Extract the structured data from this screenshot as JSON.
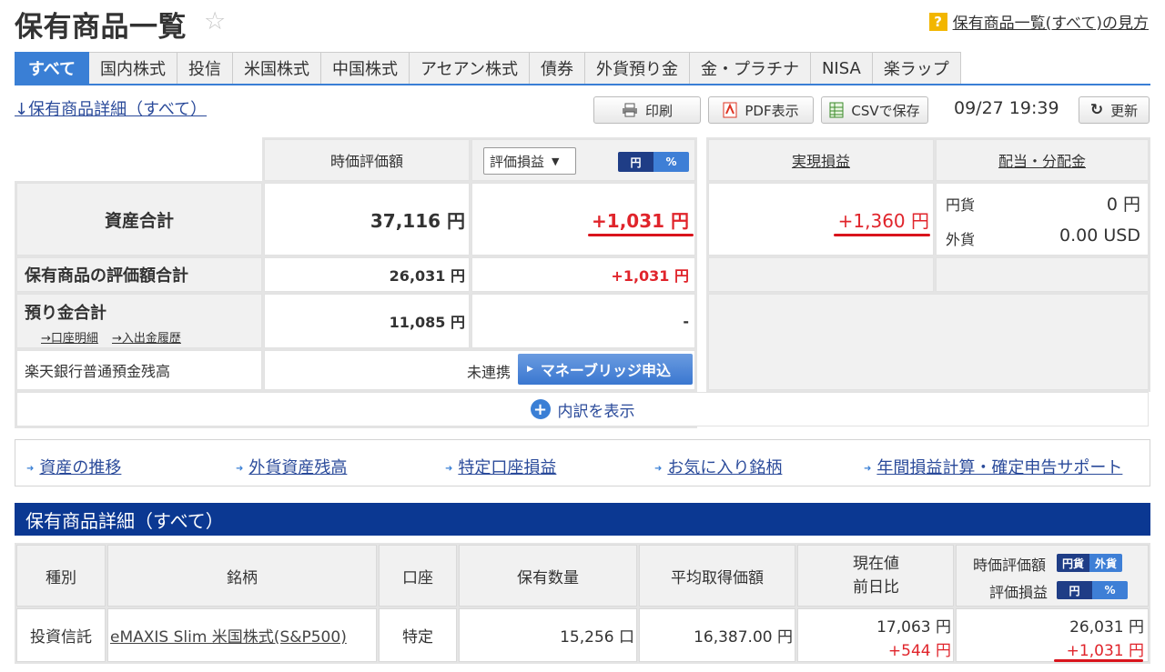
{
  "header": {
    "title": "保有商品一覧",
    "help_link": "保有商品一覧(すべて)の見方"
  },
  "tabs": [
    "すべて",
    "国内株式",
    "投信",
    "米国株式",
    "中国株式",
    "アセアン株式",
    "債券",
    "外貨預り金",
    "金・プラチナ",
    "NISA",
    "楽ラップ"
  ],
  "toolbar": {
    "detail_link": "↓保有商品詳細（すべて）",
    "print": "印刷",
    "pdf": "PDF表示",
    "csv": "CSVで保存",
    "timestamp": "09/27 19:39",
    "refresh": "更新"
  },
  "summary": {
    "col_valuation": "時価評価額",
    "pl_select": "評価損益",
    "toggle_yen": "円",
    "toggle_pct": "%",
    "col_realized": "実現損益",
    "col_dividend": "配当・分配金",
    "total_label": "資産合計",
    "total_value": "37,116 円",
    "total_pl": "+1,031 円",
    "realized": "+1,360 円",
    "div_yen_label": "円貨",
    "div_yen_value": "0 円",
    "div_fx_label": "外貨",
    "div_fx_value": "0.00 USD",
    "holdings_label": "保有商品の評価額合計",
    "holdings_value": "26,031 円",
    "holdings_pl": "+1,031 円",
    "deposit_label": "預り金合計",
    "deposit_link1": "→口座明細",
    "deposit_link2": "→入出金履歴",
    "deposit_value": "11,085 円",
    "deposit_pl": "-",
    "bank_label": "楽天銀行普通預金残高",
    "bank_status": "未連携",
    "bank_button": "マネーブリッジ申込",
    "expand": "内訳を表示"
  },
  "quicklinks": [
    "資産の推移",
    "外貨資産残高",
    "特定口座損益",
    "お気に入り銘柄",
    "年間損益計算・確定申告サポート"
  ],
  "detail": {
    "section_title": "保有商品詳細（すべて）",
    "headers": {
      "type": "種別",
      "name": "銘柄",
      "account": "口座",
      "qty": "保有数量",
      "avg": "平均取得価額",
      "price": "現在値",
      "change": "前日比",
      "val": "時価評価額",
      "val_pill_a": "円貨",
      "val_pill_b": "外貨",
      "pl": "評価損益",
      "pl_pill_a": "円",
      "pl_pill_b": "%"
    },
    "row": {
      "type": "投資信託",
      "name": "eMAXIS Slim 米国株式(S&P500)",
      "account": "特定",
      "qty": "15,256 口",
      "avg": "16,387.00 円",
      "price": "17,063 円",
      "change": "+544 円",
      "val": "26,031 円",
      "pl": "+1,031 円"
    }
  },
  "colors": {
    "accent": "#3a7fd5",
    "section": "#0b3892",
    "positive": "#e0242b"
  }
}
